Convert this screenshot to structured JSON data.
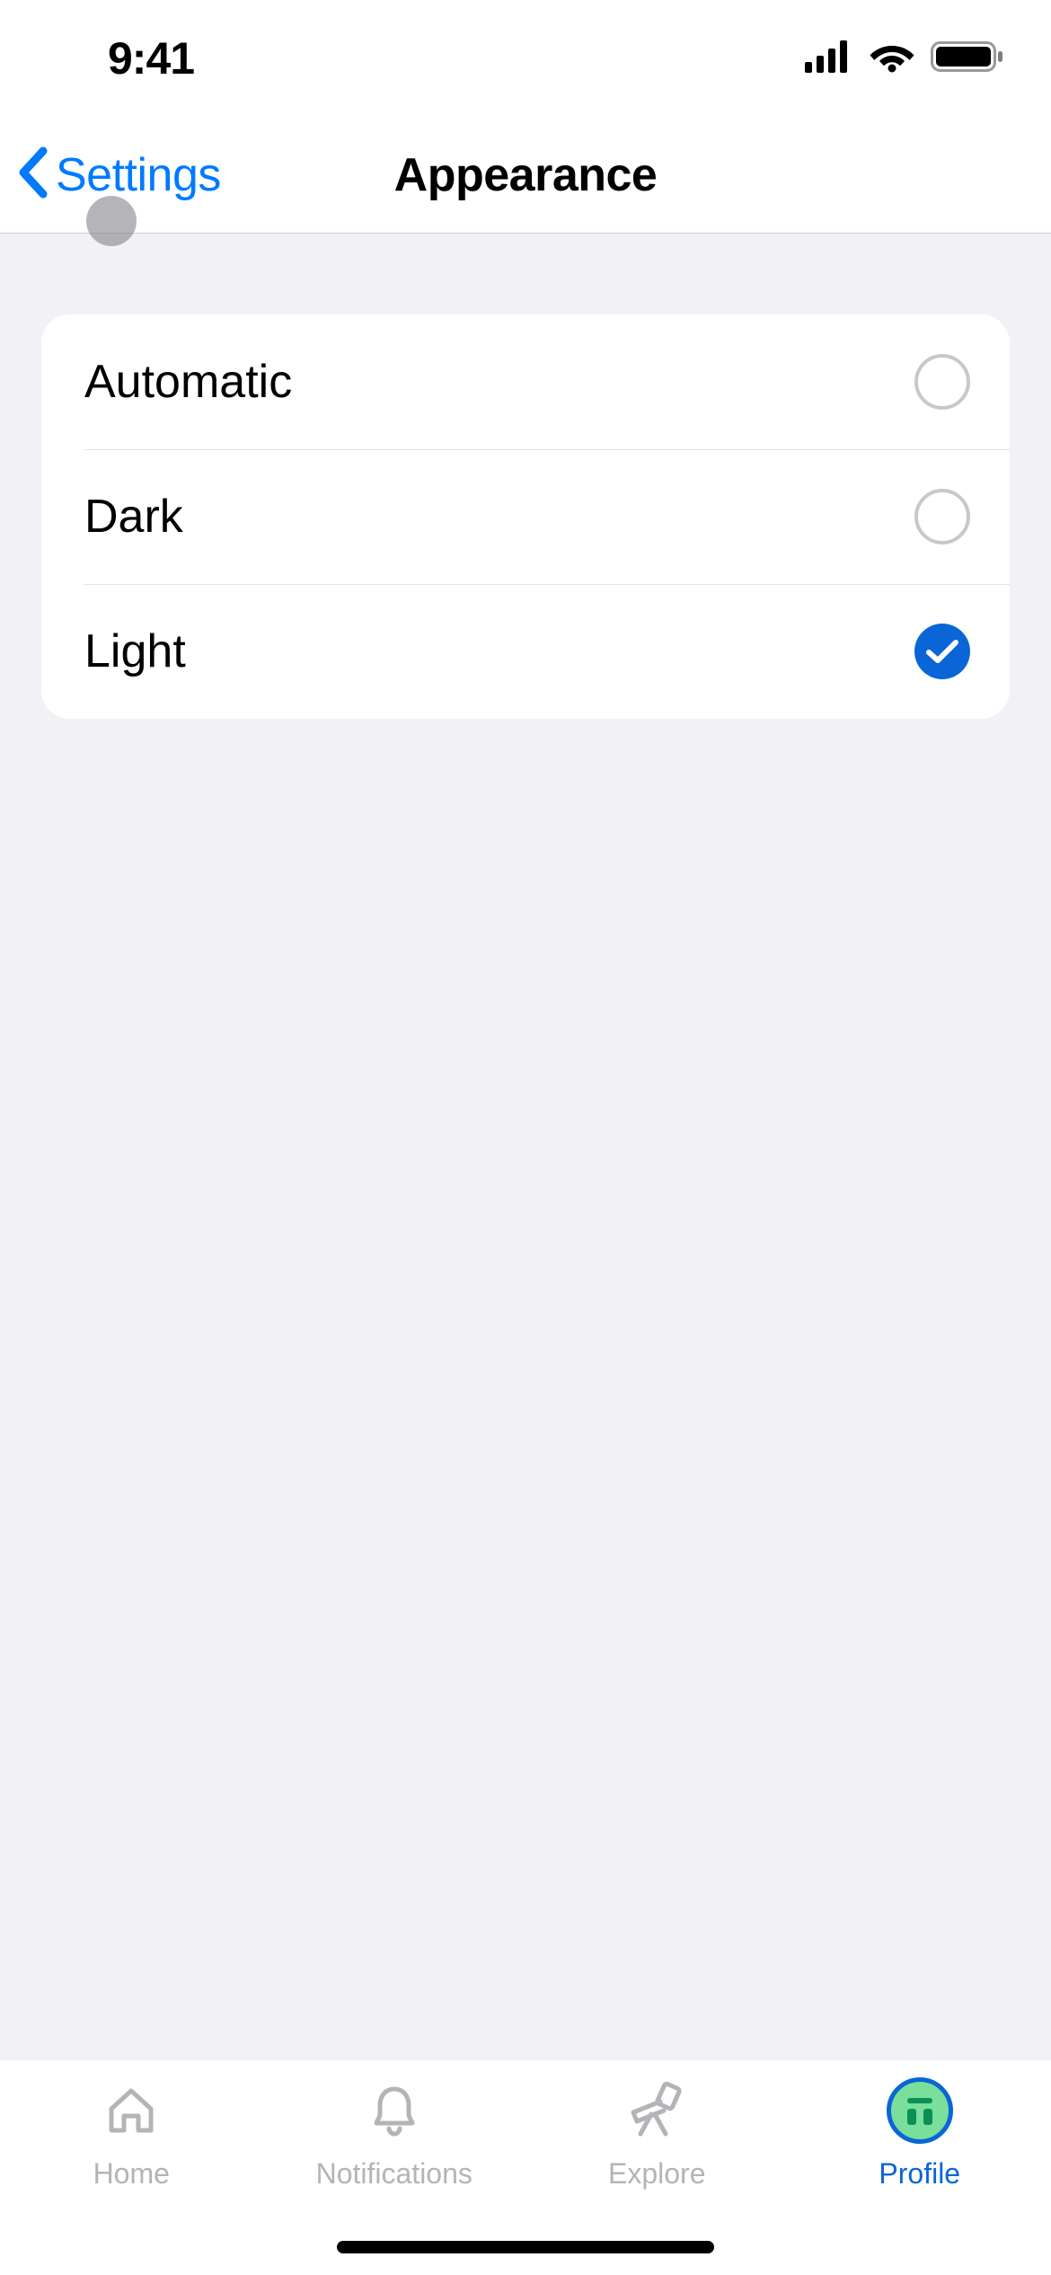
{
  "status": {
    "time": "9:41"
  },
  "nav": {
    "back_label": "Settings",
    "title": "Appearance"
  },
  "appearance": {
    "options": [
      {
        "label": "Automatic",
        "selected": false
      },
      {
        "label": "Dark",
        "selected": false
      },
      {
        "label": "Light",
        "selected": true
      }
    ]
  },
  "tabs": {
    "items": [
      {
        "label": "Home",
        "icon": "home-icon",
        "active": false
      },
      {
        "label": "Notifications",
        "icon": "bell-icon",
        "active": false
      },
      {
        "label": "Explore",
        "icon": "telescope-icon",
        "active": false
      },
      {
        "label": "Profile",
        "icon": "avatar-icon",
        "active": true
      }
    ]
  },
  "colors": {
    "accent": "#0a66d6",
    "link": "#007aff",
    "background": "#f2f2f6",
    "separator": "#e3e3e6",
    "inactive": "#b4b4b8"
  }
}
